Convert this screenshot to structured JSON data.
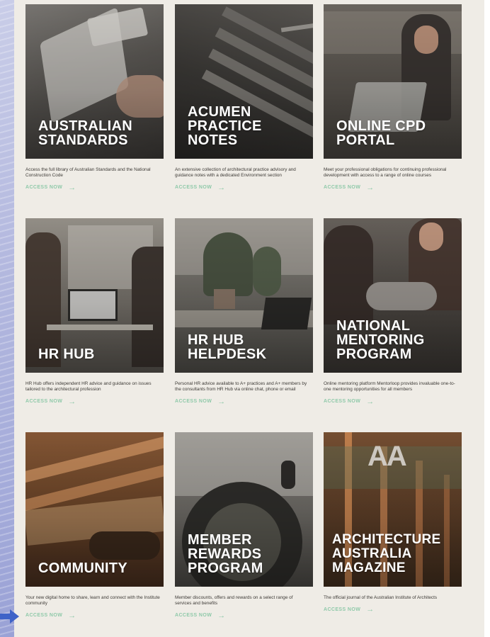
{
  "cards": [
    {
      "title": "AUSTRALIAN\nSTANDARDS",
      "description": "Access the full library of Australian Standards and the National Construction Code",
      "cta": "ACCESS NOW"
    },
    {
      "title": "ACUMEN\nPRACTICE\nNOTES",
      "description": "An extensive collection of architectural practice advisory and guidance notes with a dedicated Environment section",
      "cta": "ACCESS NOW"
    },
    {
      "title": "ONLINE CPD\nPORTAL",
      "description": "Meet your professional obligations for continuing professional development with access to a range of online courses",
      "cta": "ACCESS NOW"
    },
    {
      "title": "HR HUB",
      "description": "HR Hub offers independent HR advice and guidance on issues tailored to the architectural profession",
      "cta": "ACCESS NOW"
    },
    {
      "title": "HR HUB\nHELPDESK",
      "description": "Personal HR advice available to A+ practices and A+ members by the consultants from HR Hub via online chat, phone or email",
      "cta": "ACCESS NOW"
    },
    {
      "title": "NATIONAL\nMENTORING\nPROGRAM",
      "description": "Online mentoring platform Mentorloop provides invaluable one-to-one mentoring opportunities for all members",
      "cta": "ACCESS NOW"
    },
    {
      "title": "COMMUNITY",
      "description": "Your new digital home to share, learn and connect with the Institute community",
      "cta": "ACCESS NOW"
    },
    {
      "title": "MEMBER\nREWARDS\nPROGRAM",
      "description": "Member discounts, offers and rewards on a select range of services and benefits",
      "cta": "ACCESS NOW"
    },
    {
      "title": "ARCHITECTURE\nAUSTRALIA\nMAGAZINE",
      "description": "The official journal of the Australian Institute of Architects",
      "cta": "ACCESS NOW",
      "logo_text": "AA"
    }
  ],
  "icons": {
    "cta_arrow": "→",
    "pointer": "pointer-arrow-icon"
  },
  "colors": {
    "page_background": "#efece6",
    "cta_green": "#8fc9a9",
    "pointer_blue": "#3f63c8"
  }
}
